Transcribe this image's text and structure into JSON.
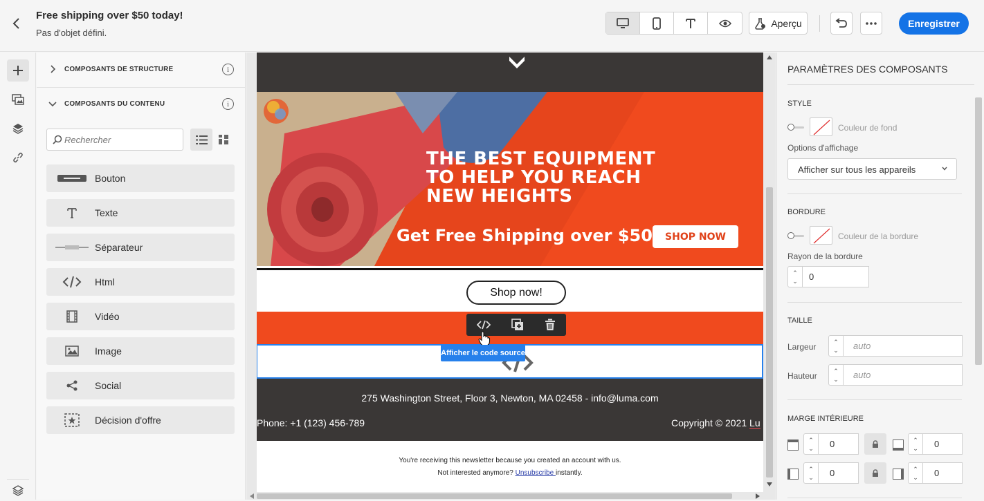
{
  "header": {
    "title": "Free shipping over $50 today!",
    "subtitle": "Pas d'objet défini.",
    "preview_label": "Aperçu",
    "save_label": "Enregistrer"
  },
  "left_panel": {
    "structure_section": "COMPOSANTS DE STRUCTURE",
    "content_section": "COMPOSANTS DU CONTENU",
    "search_placeholder": "Rechercher",
    "components": [
      {
        "label": "Bouton",
        "icon": "button-icon"
      },
      {
        "label": "Texte",
        "icon": "text-icon"
      },
      {
        "label": "Séparateur",
        "icon": "divider-icon"
      },
      {
        "label": "Html",
        "icon": "html-icon"
      },
      {
        "label": "Vidéo",
        "icon": "video-icon"
      },
      {
        "label": "Image",
        "icon": "image-icon"
      },
      {
        "label": "Social",
        "icon": "social-icon"
      },
      {
        "label": "Décision d'offre",
        "icon": "offer-decision-icon"
      }
    ]
  },
  "email": {
    "hero_lines": [
      "THE BEST EQUIPMENT",
      "TO HELP YOU REACH",
      "NEW HEIGHTS"
    ],
    "hero_tagline": "Get Free Shipping over $50",
    "hero_cta": "SHOP NOW",
    "shop_button": "Shop now!",
    "tooltip": "Afficher le code source",
    "address": "275 Washington Street, Floor 3, Newton, MA 02458 - info@luma.com",
    "phone": "Phone: +1 (123) 456-789",
    "copyright_prefix": "Copyright © 2021 ",
    "copyright_brand": "Lu",
    "note_line1": "You're receiving this newsletter because you created an account with us.",
    "note_line2_prefix": "Not interested anymore? ",
    "unsubscribe": "Unsubscribe ",
    "note_line2_suffix": "instantly."
  },
  "right_panel": {
    "title": "PARAMÈTRES DES COMPOSANTS",
    "style_section": "STYLE",
    "bg_color_label": "Couleur de fond",
    "display_options_label": "Options d'affichage",
    "display_option_value": "Afficher sur tous les appareils",
    "border_section": "BORDURE",
    "border_color_label": "Couleur de la bordure",
    "border_radius_label": "Rayon de la bordure",
    "border_radius_value": "0",
    "size_section": "TAILLE",
    "width_label": "Largeur",
    "width_placeholder": "auto",
    "height_label": "Hauteur",
    "height_placeholder": "auto",
    "padding_section": "MARGE INTÉRIEURE",
    "padding_top": "0",
    "padding_bottom": "0",
    "padding_left": "0",
    "padding_right": "0"
  },
  "colors": {
    "accent": "#1473e6",
    "email_orange": "#f04a1e",
    "email_dark": "#3a3736",
    "selection_blue": "#2680eb"
  }
}
